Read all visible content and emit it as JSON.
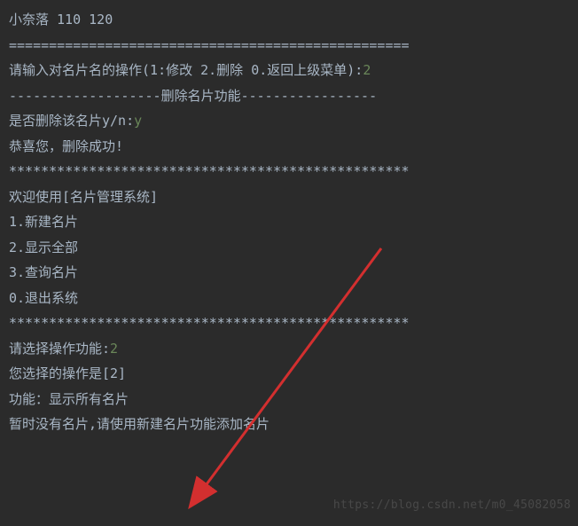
{
  "lines": {
    "l1": "小奈落 110 120",
    "l2": "==================================================",
    "l3_prompt": "请输入对名片名的操作(1:修改 2.删除 0.返回上级菜单):",
    "l3_input": "2",
    "l4": "-------------------删除名片功能-----------------",
    "l5_prompt": "是否删除该名片y/n:",
    "l5_input": "y",
    "l6": "恭喜您，删除成功!",
    "l7": "**************************************************",
    "l8": "欢迎使用[名片管理系统]",
    "l9": "1.新建名片",
    "l10": "2.显示全部",
    "l11": "3.查询名片",
    "l12": "0.退出系统",
    "l13": "**************************************************",
    "l14_prompt": "请选择操作功能:",
    "l14_input": "2",
    "l15": "您选择的操作是[2]",
    "l16": "",
    "l17": "功能：显示所有名片",
    "l18": "暂时没有名片,请使用新建名片功能添加名片"
  },
  "watermark": "https://blog.csdn.net/m0_45082058"
}
